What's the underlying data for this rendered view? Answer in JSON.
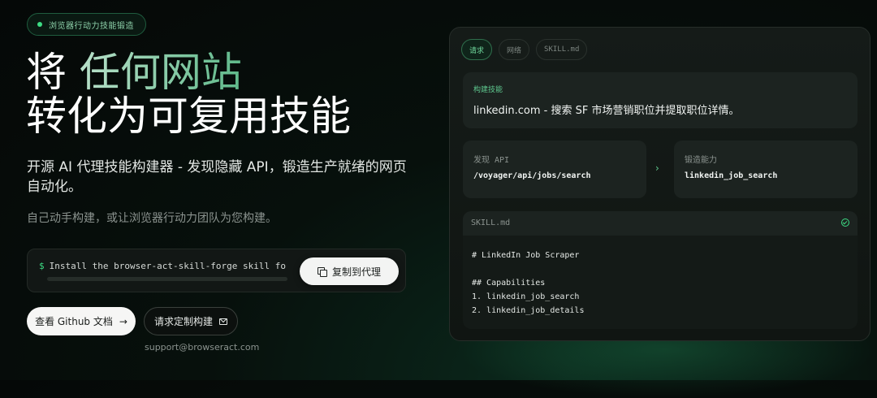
{
  "badge": {
    "text": "浏览器行动力技能锻造"
  },
  "hero": {
    "title_line1_a": "将",
    "title_line1_b": "任何网站",
    "title_line2": "转化为可复用技能",
    "description": "开源 AI 代理技能构建器 - 发现隐藏 API，锻造生产就绪的网页自动化。",
    "subtitle": "自己动手构建，或让浏览器行动力团队为您构建。"
  },
  "command": {
    "prompt": "$",
    "text": "Install the browser-act-skill-forge skill for my ag",
    "copy_label": "复制到代理"
  },
  "buttons": {
    "github_label": "查看 Github 文档",
    "github_arrow": "→",
    "request_label": "请求定制构建"
  },
  "contact_email": "support@browseract.com",
  "panel": {
    "tabs": [
      {
        "label": "请求",
        "active": true
      },
      {
        "label": "网络",
        "active": false
      },
      {
        "label": "SKILL.md",
        "active": false
      }
    ],
    "build": {
      "label": "构建技能",
      "value": "linkedin.com - 搜索 SF 市场营销职位并提取职位详情。"
    },
    "discover": {
      "label": "发现 API",
      "value": "/voyager/api/jobs/search"
    },
    "arrow": "›",
    "forge": {
      "label": "锻造能力",
      "value": "linkedin_job_search"
    },
    "skill": {
      "filename": "SKILL.md",
      "lines": [
        "# LinkedIn Job Scraper",
        "",
        "## Capabilities",
        "1. linkedin_job_search",
        "2. linkedin_job_details"
      ]
    }
  },
  "colors": {
    "accent": "#3ddc84",
    "background": "#050807"
  }
}
